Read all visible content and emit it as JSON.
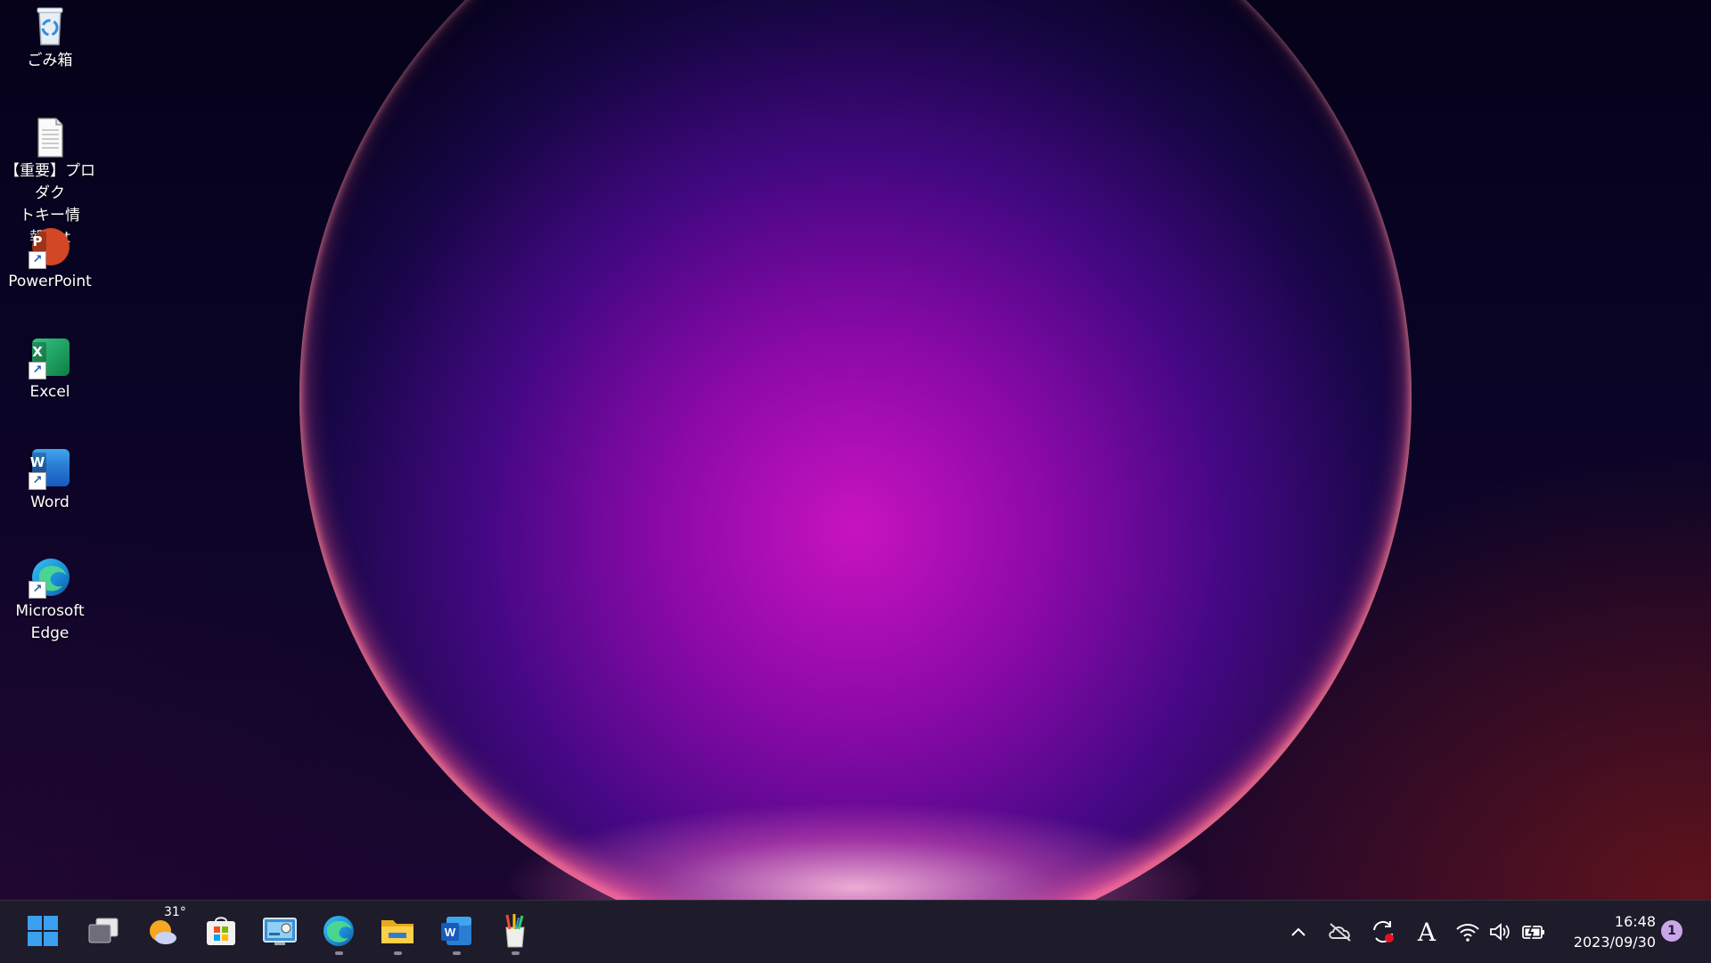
{
  "desktop": {
    "icons": [
      {
        "label": "ごみ箱",
        "icon": "recycle-bin-icon"
      },
      {
        "label": "【重要】プロダクトキー情報.txt",
        "line1": "【重要】プロダク",
        "line2": "トキー情報.txt",
        "icon": "text-file-icon"
      },
      {
        "label": "PowerPoint",
        "icon": "powerpoint-icon",
        "letter": "P"
      },
      {
        "label": "Excel",
        "icon": "excel-icon",
        "letter": "X"
      },
      {
        "label": "Word",
        "icon": "word-icon",
        "letter": "W"
      },
      {
        "label": "Microsoft Edge",
        "line1": "Microsoft",
        "line2": "Edge",
        "icon": "edge-icon"
      }
    ]
  },
  "taskbar": {
    "weather_temp": "31°",
    "pinned": [
      "start-icon",
      "task-view-icon",
      "weather-icon",
      "microsoft-store-icon",
      "control-panel-icon",
      "edge-icon",
      "file-explorer-icon",
      "word-icon",
      "paint-icon"
    ],
    "tray_icons": [
      "chevron-up-icon",
      "onedrive-offline-icon",
      "sync-icon",
      "ime-icon",
      "wifi-icon",
      "volume-icon",
      "battery-icon"
    ],
    "ime_label": "A",
    "clock_time": "16:48",
    "clock_date": "2023/09/30",
    "notification_count": "1"
  },
  "colors": {
    "taskbar_bg": "#1e1b2a",
    "powerpoint": "#d24726",
    "excel": "#1d7044",
    "word": "#2b5cbe",
    "accent_windows": "#3aa0f0"
  }
}
